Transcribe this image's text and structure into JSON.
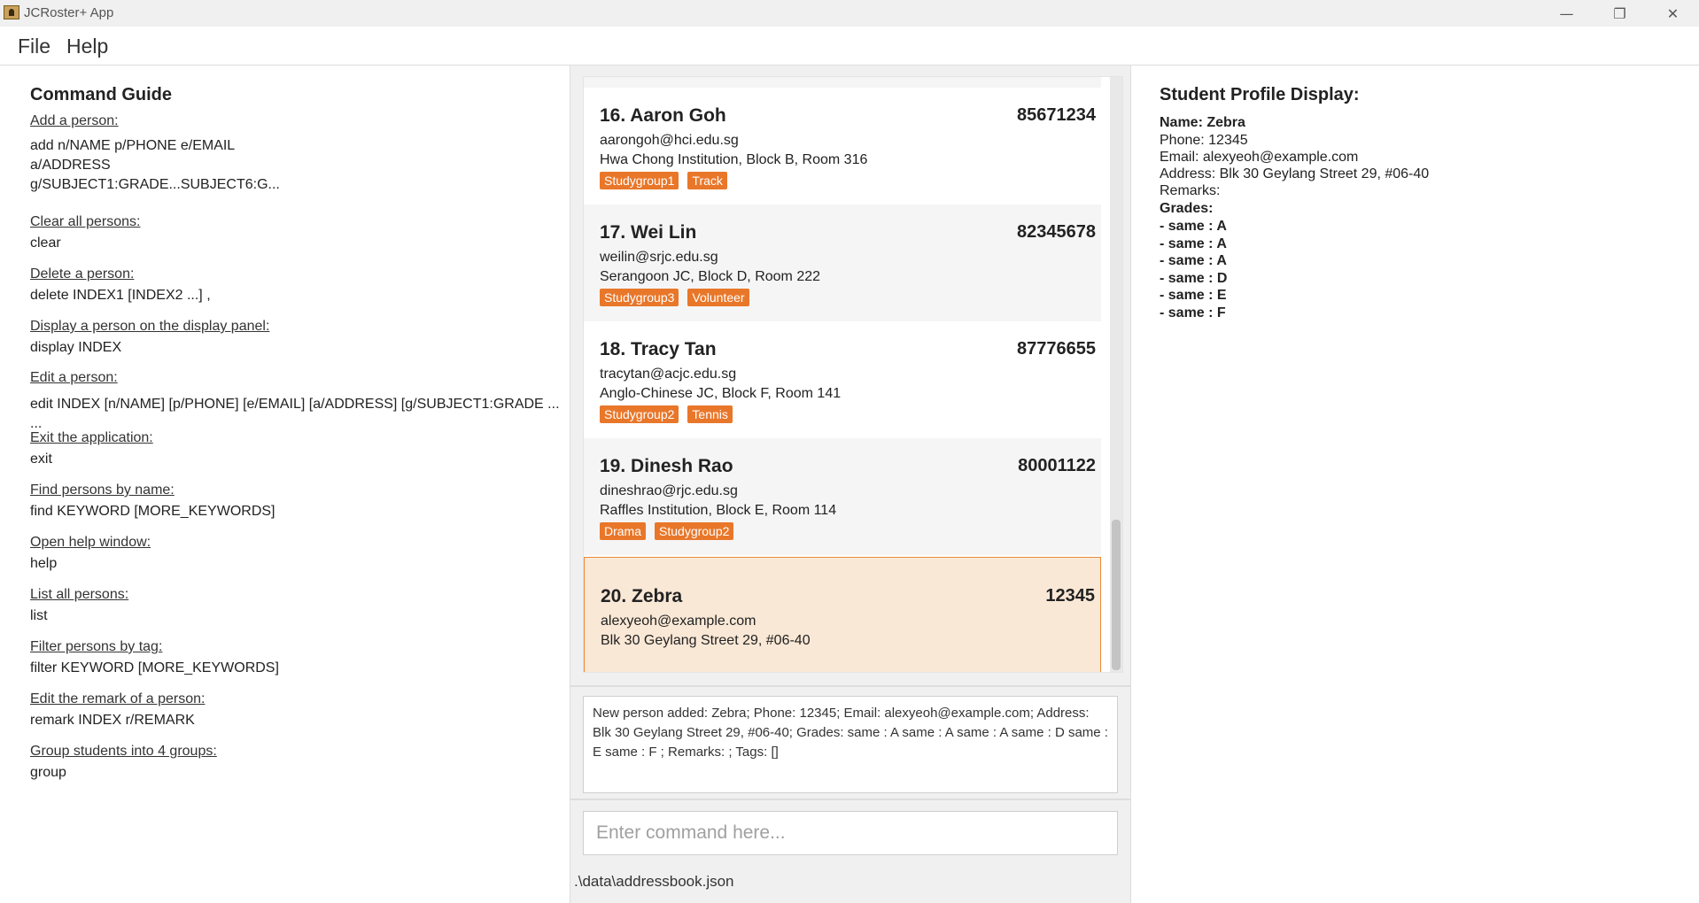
{
  "window": {
    "title": "JCRoster+ App",
    "minimize": "—",
    "maximize": "❐",
    "close": "✕"
  },
  "menu": {
    "file": "File",
    "help": "Help"
  },
  "guide": {
    "title": "Command Guide",
    "entries": [
      {
        "label": "Add a person: ",
        "cmd": "add n/NAME p/PHONE e/EMAIL\na/ADDRESS\ng/SUBJECT1:GRADE...SUBJECT6:G..."
      },
      {
        "label": "Clear all persons: ",
        "cmd": "clear"
      },
      {
        "label": "Delete a person: ",
        "cmd": "delete INDEX1 [INDEX2 ...] ,"
      },
      {
        "label": "Display a person on the display panel: ",
        "cmd": "display INDEX"
      },
      {
        "label": "Edit a person: ",
        "cmd": "edit INDEX [n/NAME] [p/PHONE] [e/EMAIL] [a/ADDRESS] [g/SUBJECT1:GRADE ... ..."
      },
      {
        "label": "Exit the application: ",
        "cmd": "exit"
      },
      {
        "label": "Find persons by name: ",
        "cmd": "find KEYWORD [MORE_KEYWORDS]"
      },
      {
        "label": "Open help window: ",
        "cmd": "help"
      },
      {
        "label": "List all persons: ",
        "cmd": "list"
      },
      {
        "label": "Filter persons by tag: ",
        "cmd": "filter KEYWORD [MORE_KEYWORDS]"
      },
      {
        "label": "Edit the remark of a person: ",
        "cmd": "remark INDEX r/REMARK"
      },
      {
        "label": "Group students into 4 groups: ",
        "cmd": "group"
      }
    ]
  },
  "persons": [
    {
      "name": "16. Aaron Goh",
      "phone": "85671234",
      "email": "aarongoh@hci.edu.sg",
      "address": "Hwa Chong Institution, Block B, Room 316",
      "tags": [
        "Studygroup1",
        "Track"
      ]
    },
    {
      "name": "17. Wei Lin",
      "phone": "82345678",
      "email": "weilin@srjc.edu.sg",
      "address": "Serangoon JC, Block D, Room 222",
      "tags": [
        "Studygroup3",
        "Volunteer"
      ]
    },
    {
      "name": "18. Tracy Tan",
      "phone": "87776655",
      "email": "tracytan@acjc.edu.sg",
      "address": "Anglo-Chinese JC, Block F, Room 141",
      "tags": [
        "Studygroup2",
        "Tennis"
      ]
    },
    {
      "name": "19. Dinesh Rao",
      "phone": "80001122",
      "email": "dineshrao@rjc.edu.sg",
      "address": "Raffles Institution, Block E, Room 114",
      "tags": [
        "Drama",
        "Studygroup2"
      ]
    },
    {
      "name": "20. Zebra",
      "phone": "12345",
      "email": "alexyeoh@example.com",
      "address": "Blk 30 Geylang Street 29, #06-40",
      "tags": [],
      "selected": true
    }
  ],
  "result": {
    "text": "New person added: Zebra; Phone: 12345; Email: alexyeoh@example.com; Address: Blk 30 Geylang Street 29, #06-40; Grades: same : A same : A same : A same : D same : E same : F ; Remarks: ; Tags: []"
  },
  "command": {
    "placeholder": "Enter command here..."
  },
  "status": {
    "file_path": ".\\data\\addressbook.json"
  },
  "profile": {
    "title": "Student Profile Display:",
    "name": "Name: Zebra",
    "phone": "Phone: 12345",
    "email": "Email: alexyeoh@example.com",
    "address": "Address: Blk 30 Geylang Street 29, #06-40",
    "remarks": "Remarks:",
    "grades_label": "Grades:",
    "grades": [
      "- same : A",
      "- same : A",
      "- same : A",
      "- same : D",
      "- same : E",
      "- same : F"
    ]
  },
  "colors": {
    "tag": "#e9772a",
    "selected_bg": "#fae8d6",
    "selected_border": "#e9893a"
  }
}
